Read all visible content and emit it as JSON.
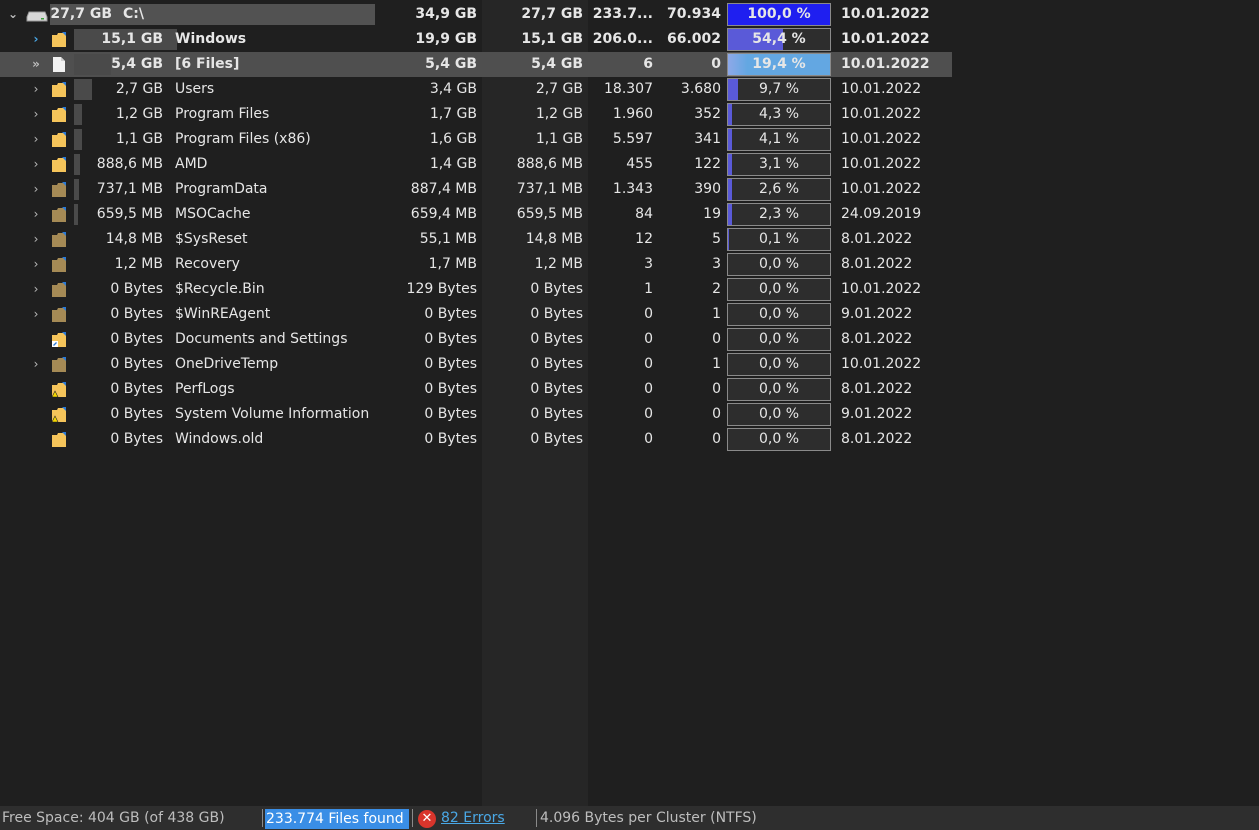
{
  "tree": {
    "rows": [
      {
        "size": "27,7 GB",
        "name": "C:\\",
        "allocated": "34,9 GB",
        "size2": "27,7 GB",
        "files": "233.7...",
        "folders": "70.934",
        "percent": "100,0 %",
        "percent_value": 100.0,
        "date": "10.01.2022",
        "expand": "⌄",
        "icon": "drive-icon",
        "bar_fraction": 1.0
      },
      {
        "size": "15,1 GB",
        "name": "Windows",
        "allocated": "19,9 GB",
        "size2": "15,1 GB",
        "files": "206.0...",
        "folders": "66.002",
        "percent": "54,4 %",
        "percent_value": 54.4,
        "date": "10.01.2022",
        "expand": "›",
        "icon": "folder-icon",
        "bar_fraction": 0.544
      },
      {
        "size": "5,4 GB",
        "name": "[6 Files]",
        "allocated": "5,4 GB",
        "size2": "5,4 GB",
        "files": "6",
        "folders": "0",
        "percent": "19,4 %",
        "percent_value": 19.4,
        "date": "10.01.2022",
        "expand": "»",
        "icon": "file-icon",
        "bar_fraction": 0.194
      },
      {
        "size": "2,7 GB",
        "name": "Users",
        "allocated": "3,4 GB",
        "size2": "2,7 GB",
        "files": "18.307",
        "folders": "3.680",
        "percent": "9,7 %",
        "percent_value": 9.7,
        "date": "10.01.2022",
        "expand": "›",
        "icon": "folder-icon",
        "bar_fraction": 0.097
      },
      {
        "size": "1,2 GB",
        "name": "Program Files",
        "allocated": "1,7 GB",
        "size2": "1,2 GB",
        "files": "1.960",
        "folders": "352",
        "percent": "4,3 %",
        "percent_value": 4.3,
        "date": "10.01.2022",
        "expand": "›",
        "icon": "folder-icon",
        "bar_fraction": 0.043
      },
      {
        "size": "1,1 GB",
        "name": "Program Files (x86)",
        "allocated": "1,6 GB",
        "size2": "1,1 GB",
        "files": "5.597",
        "folders": "341",
        "percent": "4,1 %",
        "percent_value": 4.1,
        "date": "10.01.2022",
        "expand": "›",
        "icon": "folder-icon",
        "bar_fraction": 0.041
      },
      {
        "size": "888,6 MB",
        "name": "AMD",
        "allocated": "1,4 GB",
        "size2": "888,6 MB",
        "files": "455",
        "folders": "122",
        "percent": "3,1 %",
        "percent_value": 3.1,
        "date": "10.01.2022",
        "expand": "›",
        "icon": "folder-icon",
        "bar_fraction": 0.031
      },
      {
        "size": "737,1 MB",
        "name": "ProgramData",
        "allocated": "887,4 MB",
        "size2": "737,1 MB",
        "files": "1.343",
        "folders": "390",
        "percent": "2,6 %",
        "percent_value": 2.6,
        "date": "10.01.2022",
        "expand": "›",
        "icon": "hidden-folder-icon",
        "bar_fraction": 0.026
      },
      {
        "size": "659,5 MB",
        "name": "MSOCache",
        "allocated": "659,4 MB",
        "size2": "659,5 MB",
        "files": "84",
        "folders": "19",
        "percent": "2,3 %",
        "percent_value": 2.3,
        "date": "24.09.2019",
        "expand": "›",
        "icon": "hidden-folder-icon",
        "bar_fraction": 0.023
      },
      {
        "size": "14,8 MB",
        "name": "$SysReset",
        "allocated": "55,1 MB",
        "size2": "14,8 MB",
        "files": "12",
        "folders": "5",
        "percent": "0,1 %",
        "percent_value": 0.1,
        "date": "8.01.2022",
        "expand": "›",
        "icon": "hidden-folder-icon",
        "bar_fraction": 0.001
      },
      {
        "size": "1,2 MB",
        "name": "Recovery",
        "allocated": "1,7 MB",
        "size2": "1,2 MB",
        "files": "3",
        "folders": "3",
        "percent": "0,0 %",
        "percent_value": 0.0,
        "date": "8.01.2022",
        "expand": "›",
        "icon": "hidden-folder-icon",
        "bar_fraction": 0.0
      },
      {
        "size": "0 Bytes",
        "name": "$Recycle.Bin",
        "allocated": "129 Bytes",
        "size2": "0 Bytes",
        "files": "1",
        "folders": "2",
        "percent": "0,0 %",
        "percent_value": 0.0,
        "date": "10.01.2022",
        "expand": "›",
        "icon": "hidden-folder-icon",
        "bar_fraction": 0.0
      },
      {
        "size": "0 Bytes",
        "name": "$WinREAgent",
        "allocated": "0 Bytes",
        "size2": "0 Bytes",
        "files": "0",
        "folders": "1",
        "percent": "0,0 %",
        "percent_value": 0.0,
        "date": "9.01.2022",
        "expand": "›",
        "icon": "hidden-folder-icon",
        "bar_fraction": 0.0
      },
      {
        "size": "0 Bytes",
        "name": "Documents and Settings",
        "allocated": "0 Bytes",
        "size2": "0 Bytes",
        "files": "0",
        "folders": "0",
        "percent": "0,0 %",
        "percent_value": 0.0,
        "date": "8.01.2022",
        "expand": "",
        "icon": "shortcut-folder-icon",
        "bar_fraction": 0.0
      },
      {
        "size": "0 Bytes",
        "name": "OneDriveTemp",
        "allocated": "0 Bytes",
        "size2": "0 Bytes",
        "files": "0",
        "folders": "1",
        "percent": "0,0 %",
        "percent_value": 0.0,
        "date": "10.01.2022",
        "expand": "›",
        "icon": "hidden-folder-icon",
        "bar_fraction": 0.0
      },
      {
        "size": "0 Bytes",
        "name": "PerfLogs",
        "allocated": "0 Bytes",
        "size2": "0 Bytes",
        "files": "0",
        "folders": "0",
        "percent": "0,0 %",
        "percent_value": 0.0,
        "date": "8.01.2022",
        "expand": "",
        "icon": "warning-folder-icon",
        "bar_fraction": 0.0
      },
      {
        "size": "0 Bytes",
        "name": "System Volume Information",
        "allocated": "0 Bytes",
        "size2": "0 Bytes",
        "files": "0",
        "folders": "0",
        "percent": "0,0 %",
        "percent_value": 0.0,
        "date": "9.01.2022",
        "expand": "",
        "icon": "warning-folder-icon",
        "bar_fraction": 0.0
      },
      {
        "size": "0 Bytes",
        "name": "Windows.old",
        "allocated": "0 Bytes",
        "size2": "0 Bytes",
        "files": "0",
        "folders": "0",
        "percent": "0,0 %",
        "percent_value": 0.0,
        "date": "8.01.2022",
        "expand": "",
        "icon": "folder-icon",
        "bar_fraction": 0.0
      }
    ]
  },
  "statusbar": {
    "free_space": "Free Space: 404 GB  (of 438 GB)",
    "files_found": "233.774 Files found",
    "error_icon": "error-icon",
    "errors": "82 Errors",
    "cluster": "4.096 Bytes per Cluster (NTFS)"
  },
  "colors": {
    "percent_fill": "#5a5ad8",
    "top_percent_fill": "#1f1ff0",
    "selected_percent_fill": "#63a7e2",
    "status_highlight": "#3a8ee6",
    "error_red": "#d9352c"
  }
}
